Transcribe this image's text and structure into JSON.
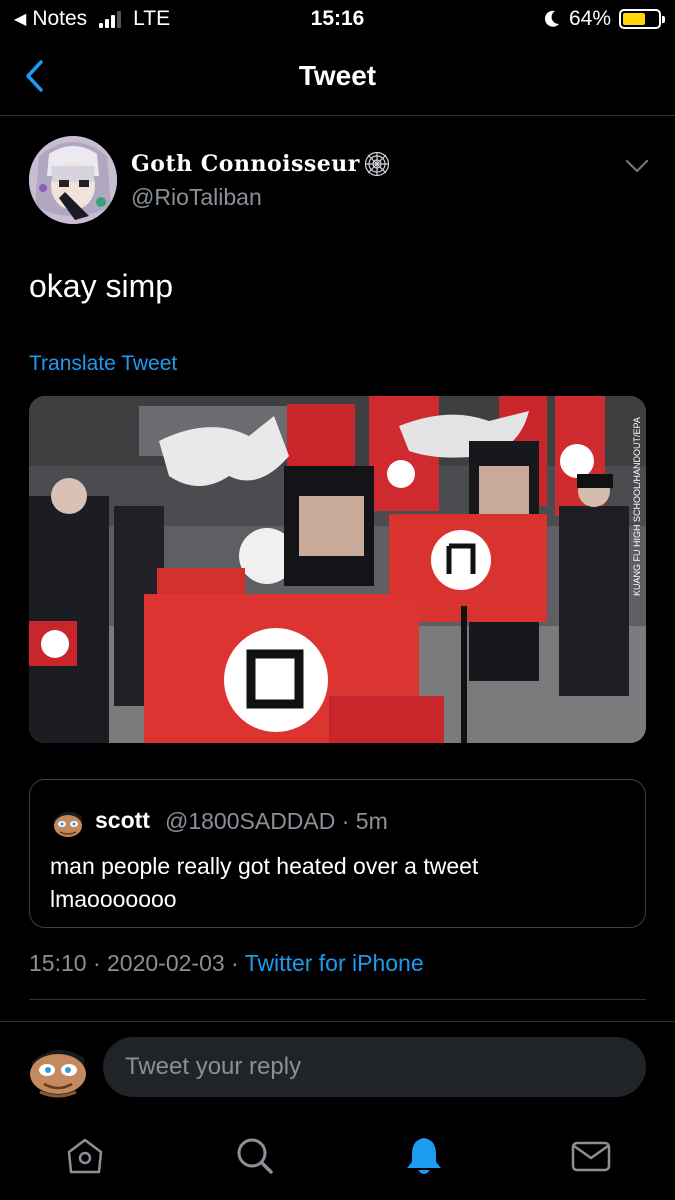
{
  "status_bar": {
    "back_app": "Notes",
    "carrier": "LTE",
    "time": "15:16",
    "battery": "64%",
    "battery_level": 0.64,
    "signal_bars": 3
  },
  "nav": {
    "title": "Tweet",
    "back_icon": "chevron-left-icon"
  },
  "tweet": {
    "author_name": "Goth Connoisseur",
    "author_handle": "@RioTaliban",
    "text": "okay simp",
    "translate_label": "Translate Tweet",
    "media_credit": "KUANG FU HIGH SCHOOL/HANDOUT/EPA",
    "timestamp": "15:10 · 2020-02-03 · ",
    "source": "Twitter for iPhone"
  },
  "quote": {
    "name": "scott",
    "meta": "@1800SADDAD · 5m",
    "text": "man people really got heated over a tweet lmaooooooo"
  },
  "reply": {
    "placeholder": "Tweet your reply"
  },
  "tabs": [
    {
      "icon": "home-icon",
      "active": false
    },
    {
      "icon": "search-icon",
      "active": false
    },
    {
      "icon": "notifications-icon",
      "active": true
    },
    {
      "icon": "messages-icon",
      "active": false
    }
  ],
  "colors": {
    "accent": "#1d9bf0",
    "muted": "#8a9098",
    "background": "#000000",
    "battery": "#ffd60a"
  }
}
